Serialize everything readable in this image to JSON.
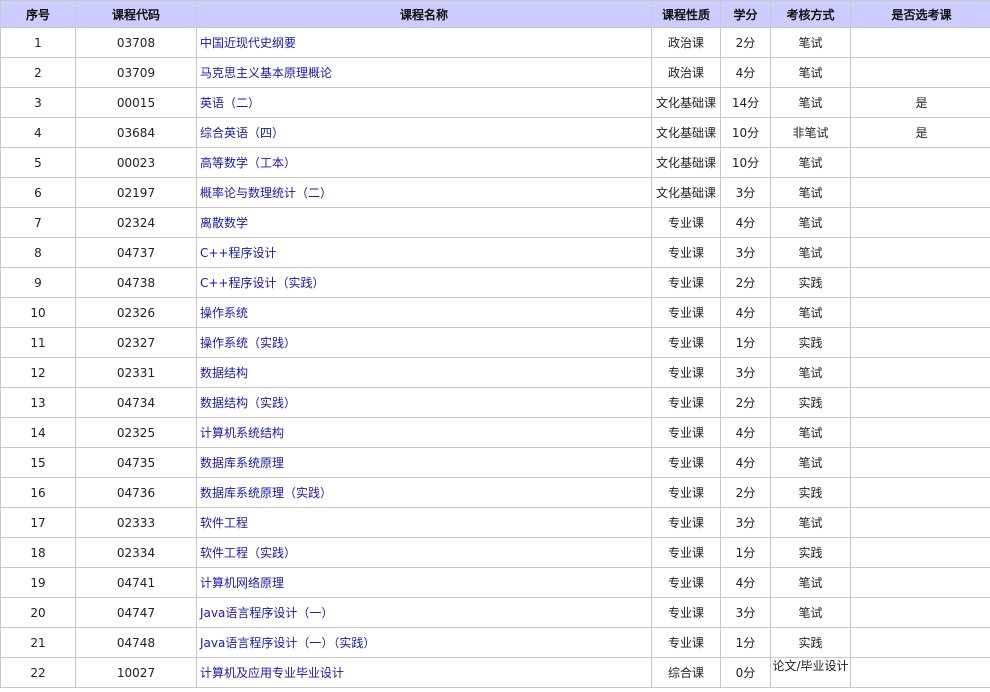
{
  "columns": [
    "序号",
    "课程代码",
    "课程名称",
    "课程性质",
    "学分",
    "考核方式",
    "是否选考课"
  ],
  "rows": [
    {
      "no": "1",
      "code": "03708",
      "name": "中国近现代史纲要",
      "type": "政治课",
      "credit": "2分",
      "assess": "笔试",
      "elective": ""
    },
    {
      "no": "2",
      "code": "03709",
      "name": "马克思主义基本原理概论",
      "type": "政治课",
      "credit": "4分",
      "assess": "笔试",
      "elective": ""
    },
    {
      "no": "3",
      "code": "00015",
      "name": "英语（二）",
      "type": "文化基础课",
      "credit": "14分",
      "assess": "笔试",
      "elective": "是"
    },
    {
      "no": "4",
      "code": "03684",
      "name": "综合英语（四）",
      "type": "文化基础课",
      "credit": "10分",
      "assess": "非笔试",
      "elective": "是"
    },
    {
      "no": "5",
      "code": "00023",
      "name": "高等数学（工本）",
      "type": "文化基础课",
      "credit": "10分",
      "assess": "笔试",
      "elective": ""
    },
    {
      "no": "6",
      "code": "02197",
      "name": "概率论与数理统计（二）",
      "type": "文化基础课",
      "credit": "3分",
      "assess": "笔试",
      "elective": ""
    },
    {
      "no": "7",
      "code": "02324",
      "name": "离散数学",
      "type": "专业课",
      "credit": "4分",
      "assess": "笔试",
      "elective": ""
    },
    {
      "no": "8",
      "code": "04737",
      "name": "C++程序设计",
      "type": "专业课",
      "credit": "3分",
      "assess": "笔试",
      "elective": ""
    },
    {
      "no": "9",
      "code": "04738",
      "name": "C++程序设计（实践）",
      "type": "专业课",
      "credit": "2分",
      "assess": "实践",
      "elective": ""
    },
    {
      "no": "10",
      "code": "02326",
      "name": "操作系统",
      "type": "专业课",
      "credit": "4分",
      "assess": "笔试",
      "elective": ""
    },
    {
      "no": "11",
      "code": "02327",
      "name": "操作系统（实践）",
      "type": "专业课",
      "credit": "1分",
      "assess": "实践",
      "elective": ""
    },
    {
      "no": "12",
      "code": "02331",
      "name": "数据结构",
      "type": "专业课",
      "credit": "3分",
      "assess": "笔试",
      "elective": ""
    },
    {
      "no": "13",
      "code": "04734",
      "name": "数据结构（实践）",
      "type": "专业课",
      "credit": "2分",
      "assess": "实践",
      "elective": ""
    },
    {
      "no": "14",
      "code": "02325",
      "name": "计算机系统结构",
      "type": "专业课",
      "credit": "4分",
      "assess": "笔试",
      "elective": ""
    },
    {
      "no": "15",
      "code": "04735",
      "name": "数据库系统原理",
      "type": "专业课",
      "credit": "4分",
      "assess": "笔试",
      "elective": ""
    },
    {
      "no": "16",
      "code": "04736",
      "name": "数据库系统原理（实践）",
      "type": "专业课",
      "credit": "2分",
      "assess": "实践",
      "elective": ""
    },
    {
      "no": "17",
      "code": "02333",
      "name": "软件工程",
      "type": "专业课",
      "credit": "3分",
      "assess": "笔试",
      "elective": ""
    },
    {
      "no": "18",
      "code": "02334",
      "name": "软件工程（实践）",
      "type": "专业课",
      "credit": "1分",
      "assess": "实践",
      "elective": ""
    },
    {
      "no": "19",
      "code": "04741",
      "name": "计算机网络原理",
      "type": "专业课",
      "credit": "4分",
      "assess": "笔试",
      "elective": ""
    },
    {
      "no": "20",
      "code": "04747",
      "name": "Java语言程序设计（一）",
      "type": "专业课",
      "credit": "3分",
      "assess": "笔试",
      "elective": ""
    },
    {
      "no": "21",
      "code": "04748",
      "name": "Java语言程序设计（一）（实践）",
      "type": "专业课",
      "credit": "1分",
      "assess": "实践",
      "elective": ""
    },
    {
      "no": "22",
      "code": "10027",
      "name": "计算机及应用专业毕业设计",
      "type": "综合课",
      "credit": "0分",
      "assess": "论文/毕业设计",
      "elective": ""
    }
  ],
  "colors": {
    "header_bg": "#ccccff",
    "link": "#1a1aa6",
    "border": "#c9c9c9"
  }
}
